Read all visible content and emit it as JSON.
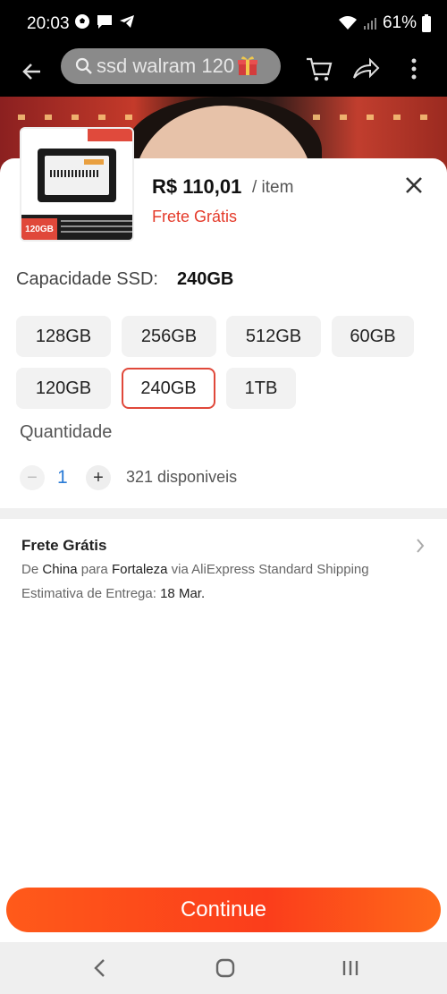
{
  "status": {
    "time": "20:03",
    "battery": "61%"
  },
  "search": {
    "query": "ssd walram 120"
  },
  "product": {
    "thumb_capacity": "120GB",
    "price": "R$ 110,01",
    "price_unit": "/ item",
    "shipping_badge": "Frete Grátis"
  },
  "capacity": {
    "label": "Capacidade SSD:",
    "selected": "240GB",
    "options": [
      "128GB",
      "256GB",
      "512GB",
      "60GB",
      "120GB",
      "240GB",
      "1TB"
    ]
  },
  "quantity": {
    "label": "Quantidade",
    "minus": "−",
    "plus": "+",
    "value": "1",
    "available": "321 disponiveis"
  },
  "shipping": {
    "title": "Frete Grátis",
    "from_prefix": "De",
    "from": "China",
    "to_prefix": "para",
    "to": "Fortaleza",
    "via_prefix": "via",
    "method": "AliExpress Standard Shipping",
    "eta_label": "Estimativa de Entrega:",
    "eta_value": "18 Mar."
  },
  "actions": {
    "continue_label": "Continue"
  },
  "colors": {
    "accent": "#e0483a",
    "price_red": "#e43a2a",
    "qty_blue": "#2a7bd6",
    "button_orange": "#fb3d1b"
  }
}
